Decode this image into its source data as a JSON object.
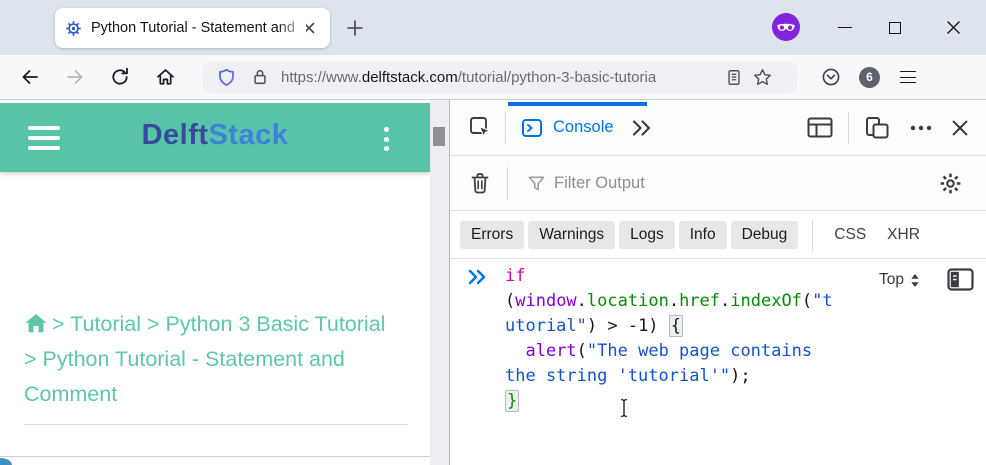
{
  "browser": {
    "tab": {
      "title": "Python Tutorial - Statement and"
    },
    "url": {
      "prefix": "https://www.",
      "domain": "delftstack.com",
      "path": "/tutorial/python-3-basic-tutoria"
    },
    "toolbar": {
      "extension_badge_count": "6"
    }
  },
  "page": {
    "header": {
      "logo_part1": "Delft",
      "logo_part2": "Stack"
    },
    "breadcrumb_items": [
      "Home",
      "Tutorial",
      "Python 3 Basic Tutorial",
      "Python Tutorial - Statement and Comment"
    ],
    "breadcrumb_lines": [
      "> Tutorial > Python 3 Basic Tutorial",
      "> Python Tutorial - Statement and",
      "Comment"
    ],
    "colors": {
      "header_bg": "#57c4a8",
      "link": "#5ec7ab",
      "logo_dark": "#39499e",
      "logo_blue": "#3f80d8"
    }
  },
  "devtools": {
    "toolbar": {
      "console_tab": "Console"
    },
    "filter_placeholder": "Filter Output",
    "filter_buttons": [
      "Errors",
      "Warnings",
      "Logs",
      "Info",
      "Debug"
    ],
    "filter_categories": [
      "CSS",
      "XHR"
    ],
    "context_selector": "Top",
    "colors": {
      "accent": "#0074e8",
      "keyword": "#dd00a9",
      "variable": "#8000d7",
      "property": "#058b00",
      "string": "#1352cc"
    },
    "console_code_lines": [
      [
        {
          "t": "if",
          "c": "kw"
        }
      ],
      [
        {
          "t": "(",
          "c": "pl"
        },
        {
          "t": "window",
          "c": "var"
        },
        {
          "t": ".",
          "c": "pl"
        },
        {
          "t": "location",
          "c": "prop"
        },
        {
          "t": ".",
          "c": "pl"
        },
        {
          "t": "href",
          "c": "prop"
        },
        {
          "t": ".",
          "c": "pl"
        },
        {
          "t": "indexOf",
          "c": "prop"
        },
        {
          "t": "(",
          "c": "pl"
        },
        {
          "t": "\"t",
          "c": "str"
        }
      ],
      [
        {
          "t": "utorial\"",
          "c": "str"
        },
        {
          "t": ") > -1) ",
          "c": "pl"
        },
        {
          "t": "{",
          "c": "bro"
        }
      ],
      [
        {
          "t": "  ",
          "c": "pl"
        },
        {
          "t": "alert",
          "c": "var"
        },
        {
          "t": "(",
          "c": "pl"
        },
        {
          "t": "\"The web page contains",
          "c": "str"
        }
      ],
      [
        {
          "t": "the string 'tutorial'\"",
          "c": "str"
        },
        {
          "t": ");",
          "c": "pl"
        }
      ],
      [
        {
          "t": "}",
          "c": "brc"
        }
      ]
    ]
  },
  "icons": {
    "favicon": "gear",
    "new_tab": "plus",
    "private_browsing": "mask",
    "minimize": "minus",
    "maximize": "square",
    "window_close": "x",
    "tab_close": "x",
    "back": "arrow-left",
    "forward": "arrow-right",
    "reload": "circular-arrow",
    "home": "house",
    "tracking_protection": "shield",
    "connection": "lock",
    "reader_mode": "document",
    "bookmark": "star",
    "pocket": "circle-chevron",
    "app_menu": "hamburger",
    "page_menu": "hamburger",
    "page_more": "kebab-dots",
    "breadcrumb_home": "house",
    "inspector_picker": "cursor-box",
    "console_tab": "terminal-chevron",
    "more_tabs": "double-chevron",
    "dock_layout": "layout-panel",
    "responsive_mode": "devices",
    "more_options": "meatballs",
    "devtools_close": "x",
    "clear_console": "trash",
    "filter": "funnel",
    "settings": "gear",
    "context_arrows": "up-down-triangles",
    "editor_sidebar": "panel-left",
    "console_prompt": "double-chevron",
    "mouse_cursor": "i-beam"
  }
}
